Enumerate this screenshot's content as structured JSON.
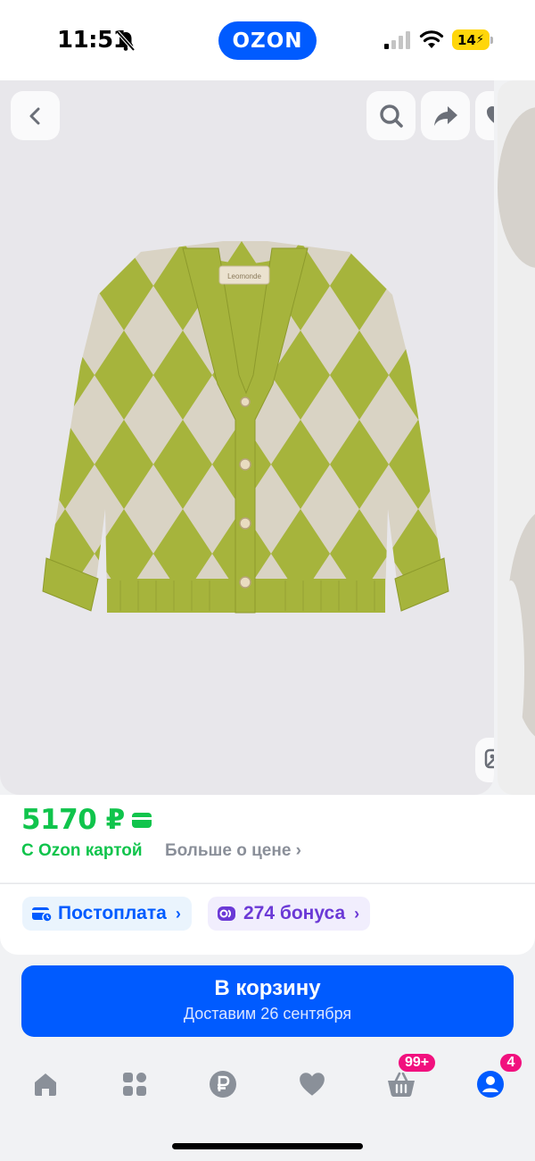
{
  "status_bar": {
    "time": "11:51",
    "logo": "OZON",
    "battery": "14"
  },
  "gallery": {
    "back_icon": "chevron-left-icon",
    "search_icon": "search-icon",
    "share_icon": "share-icon",
    "favorite_icon": "heart-icon",
    "visual_search_icon": "image-search-icon",
    "product_tag": "Leomonde",
    "colors": {
      "green": "#a6b43c",
      "beige": "#d9d3c4"
    }
  },
  "price": {
    "amount": "5170 ₽",
    "ozon_card": "С Ozon картой",
    "more": "Больше о цене ›"
  },
  "badges": {
    "postpay": "Постоплата",
    "bonus": "274 бонуса"
  },
  "cart_button": {
    "title": "В корзину",
    "subtitle": "Доставим 26 сентября"
  },
  "nav": {
    "cart_badge": "99+",
    "profile_badge": "4"
  },
  "colors": {
    "brand": "#005bff",
    "price_green": "#10c44c",
    "badge_pink": "#f1117e",
    "bonus_purple": "#6b39d6"
  }
}
